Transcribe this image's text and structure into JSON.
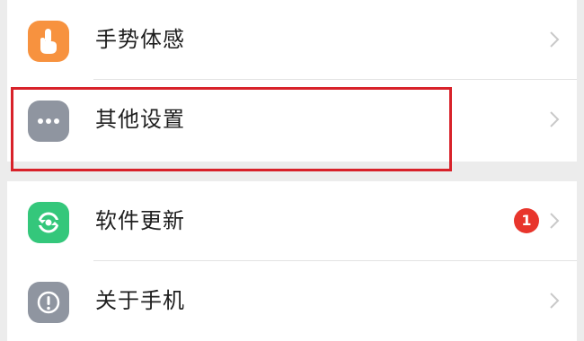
{
  "settings": {
    "group1": [
      {
        "label": "手势体感",
        "icon": "gesture-hand-icon",
        "icon_color": "#f7923f"
      },
      {
        "label": "其他设置",
        "icon": "more-dots-icon",
        "icon_color": "#8f95a0"
      }
    ],
    "group2": [
      {
        "label": "软件更新",
        "icon": "refresh-icon",
        "icon_color": "#34c77b",
        "badge": "1"
      },
      {
        "label": "关于手机",
        "icon": "info-icon",
        "icon_color": "#8f95a0"
      }
    ]
  },
  "colors": {
    "highlight": "#d8222a",
    "badge": "#e8352c",
    "background": "#ececec"
  }
}
